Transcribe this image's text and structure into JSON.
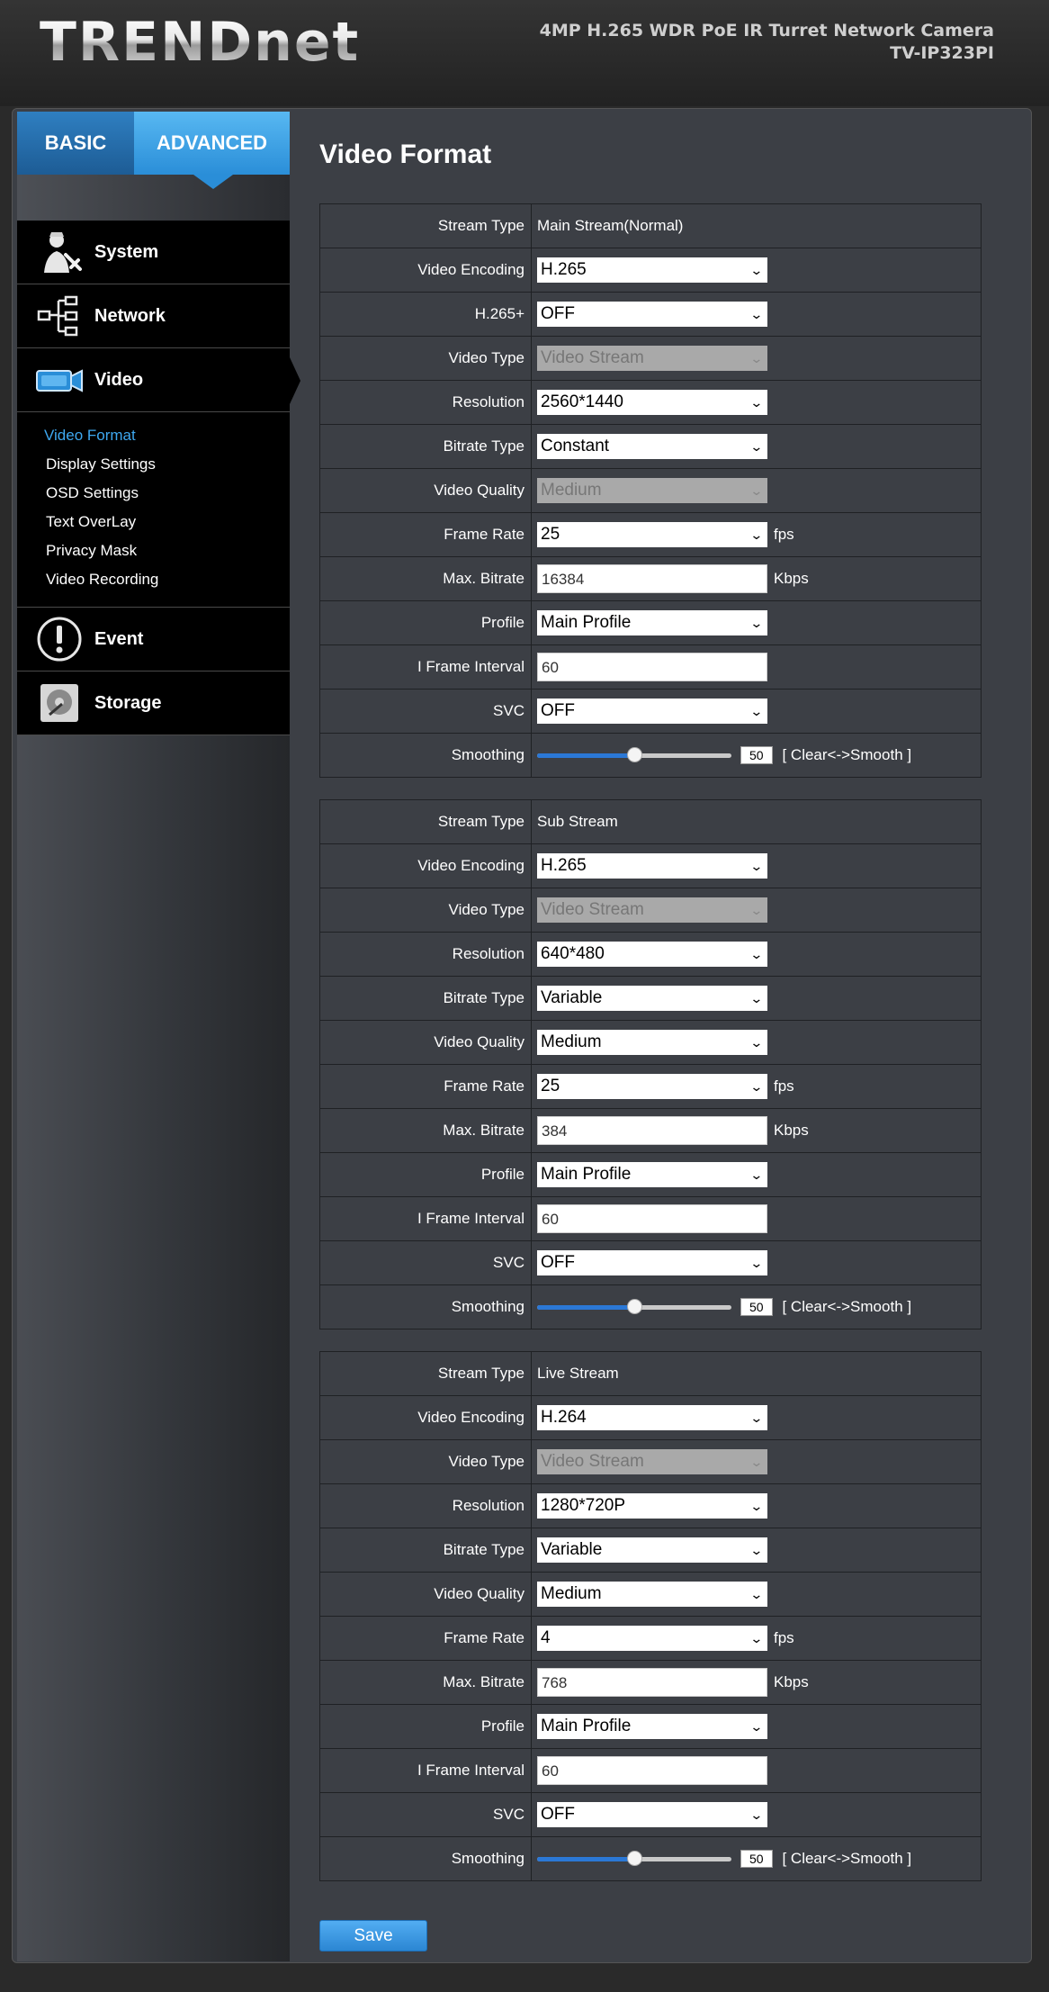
{
  "header": {
    "logo": "TRENDnet",
    "product_line": "4MP H.265 WDR PoE IR Turret Network Camera",
    "model": "TV-IP323PI"
  },
  "tabs": [
    {
      "label": "BASIC"
    },
    {
      "label": "ADVANCED"
    }
  ],
  "menu": {
    "system": "System",
    "network": "Network",
    "video": "Video",
    "event": "Event",
    "storage": "Storage",
    "video_sub": [
      "Video Format",
      "Display Settings",
      "OSD Settings",
      "Text OverLay",
      "Privacy Mask",
      "Video Recording"
    ]
  },
  "page_title": "Video Format",
  "labels": {
    "stream_type": "Stream Type",
    "video_encoding": "Video Encoding",
    "h265plus": "H.265+",
    "video_type": "Video Type",
    "resolution": "Resolution",
    "bitrate_type": "Bitrate Type",
    "video_quality": "Video Quality",
    "frame_rate": "Frame Rate",
    "max_bitrate": "Max. Bitrate",
    "profile": "Profile",
    "i_frame": "I Frame Interval",
    "svc": "SVC",
    "smoothing": "Smoothing",
    "fps": "fps",
    "kbps": "Kbps",
    "smooth_note": "[ Clear<->Smooth ]"
  },
  "main": {
    "stream_type": "Main Stream(Normal)",
    "video_encoding": "H.265",
    "h265plus": "OFF",
    "video_type": "Video Stream",
    "resolution": "2560*1440",
    "bitrate_type": "Constant",
    "video_quality": "Medium",
    "frame_rate": "25",
    "max_bitrate": "16384",
    "profile": "Main Profile",
    "i_frame": "60",
    "svc": "OFF",
    "smoothing": "50"
  },
  "sub": {
    "stream_type": "Sub Stream",
    "video_encoding": "H.265",
    "video_type": "Video Stream",
    "resolution": "640*480",
    "bitrate_type": "Variable",
    "video_quality": "Medium",
    "frame_rate": "25",
    "max_bitrate": "384",
    "profile": "Main Profile",
    "i_frame": "60",
    "svc": "OFF",
    "smoothing": "50"
  },
  "live": {
    "stream_type": "Live Stream",
    "video_encoding": "H.264",
    "video_type": "Video Stream",
    "resolution": "1280*720P",
    "bitrate_type": "Variable",
    "video_quality": "Medium",
    "frame_rate": "4",
    "max_bitrate": "768",
    "profile": "Main Profile",
    "i_frame": "60",
    "svc": "OFF",
    "smoothing": "50"
  },
  "save_label": "Save",
  "colors": {
    "accent": "#2a8ed8",
    "active_link": "#3ea8f0",
    "slider_fill": "#2b78d6"
  }
}
